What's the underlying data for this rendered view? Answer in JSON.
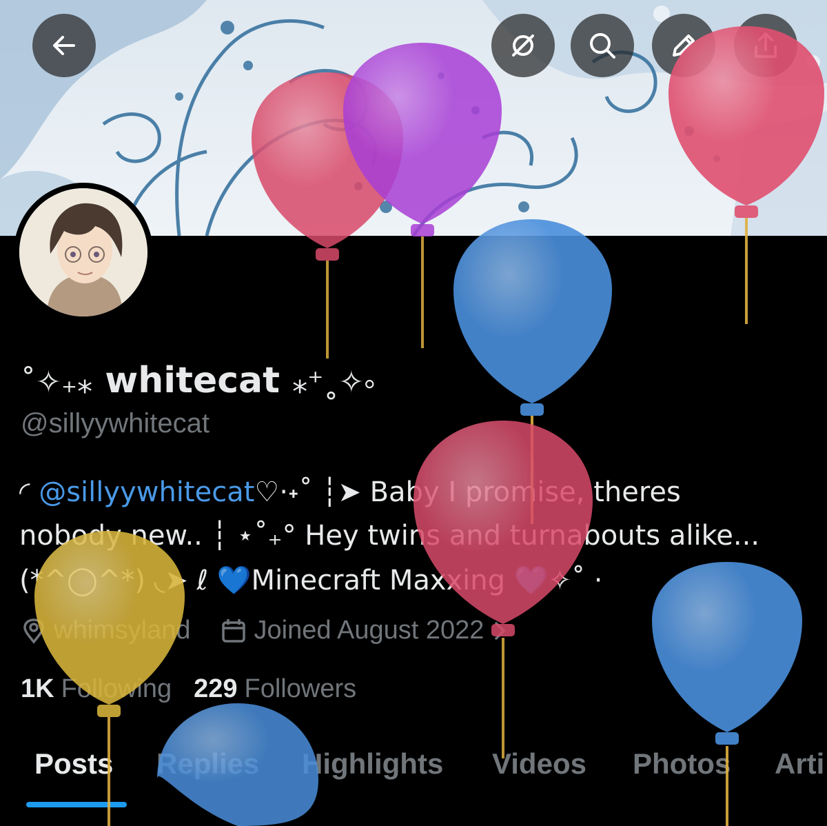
{
  "header": {
    "back_icon": "arrow-left-icon",
    "grok_icon": "grok-icon",
    "search_icon": "search-icon",
    "edit_icon": "pencil-icon",
    "share_icon": "share-icon"
  },
  "profile": {
    "display_name_prefix": "˚✧₊⁎",
    "display_name": "whitecat",
    "display_name_suffix": "⁎⁺˳✧༚",
    "handle": "@sillyywhitecat",
    "bio": {
      "line1_prefix": "◜",
      "line1_mention": "@sillyywhitecat",
      "line1_rest": "♡⋅˖˚ ┆➤ Baby I promise, theres",
      "line2": "nobody new.. ┆ ⋆˚₊° Hey twins and turnabouts alike...",
      "line3_a": "(*^◯^*) ◟➤ ℓ ",
      "line3_heart1": "💙",
      "line3_b": "Minecraft Maxxing ",
      "line3_heart2": "💙",
      "line3_c": "✧˚ ·"
    },
    "location": "whimsyland",
    "joined": "Joined August 2022",
    "location_icon": "location-pin-icon",
    "calendar_icon": "calendar-icon",
    "chevron_icon": "chevron-right-icon"
  },
  "stats": {
    "following_count": "1K",
    "following_label": "Following",
    "followers_count": "229",
    "followers_label": "Followers"
  },
  "tabs": [
    {
      "label": "Posts",
      "active": true
    },
    {
      "label": "Replies"
    },
    {
      "label": "Highlights"
    },
    {
      "label": "Videos"
    },
    {
      "label": "Photos"
    },
    {
      "label": "Arti"
    }
  ],
  "colors": {
    "background": "#000000",
    "accent": "#1d9bf0",
    "mention": "#4a9ae8",
    "muted_text": "#71767b",
    "balloon_red": "#d94a6a",
    "balloon_purple": "#a93fd6",
    "balloon_blue": "#4a8fdc",
    "balloon_yellow": "#d8b53c"
  }
}
